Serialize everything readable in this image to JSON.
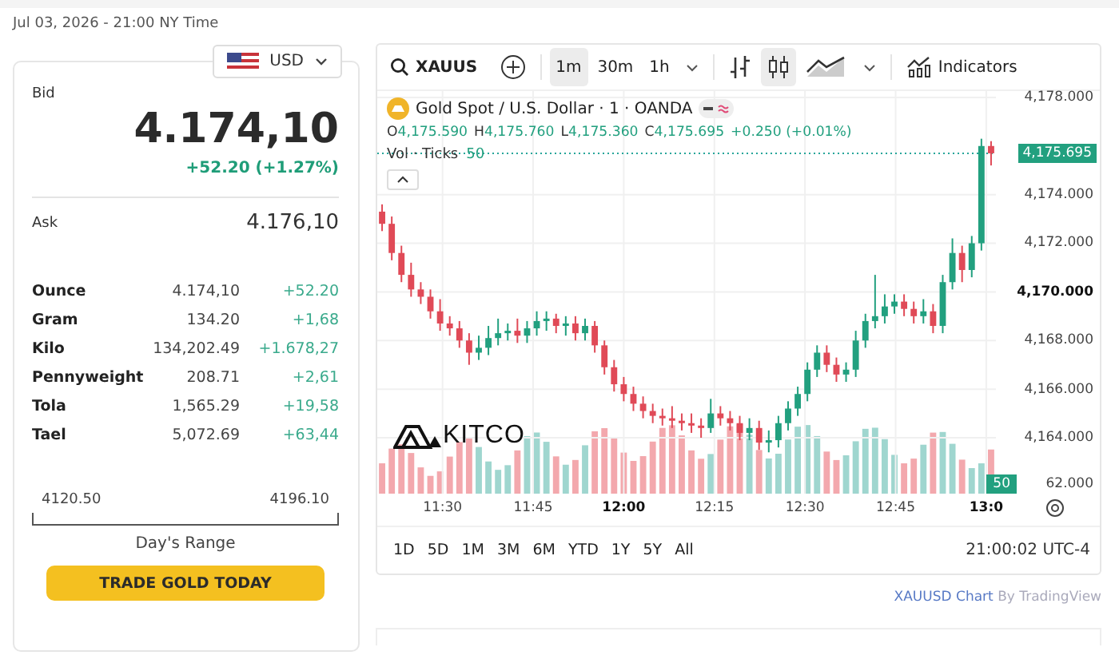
{
  "timestamp": "Jul 03, 2026 - 21:00 NY Time",
  "currency": {
    "label": "USD"
  },
  "quote": {
    "bid_label": "Bid",
    "bid": "4.174,10",
    "change": "+52.20 (+1.27%)",
    "ask_label": "Ask",
    "ask": "4.176,10"
  },
  "units": [
    {
      "name": "Ounce",
      "price": "4.174,10",
      "change": "+52.20"
    },
    {
      "name": "Gram",
      "price": "134.20",
      "change": "+1,68"
    },
    {
      "name": "Kilo",
      "price": "134,202.49",
      "change": "+1.678,27"
    },
    {
      "name": "Pennyweight",
      "price": "208.71",
      "change": "+2,61"
    },
    {
      "name": "Tola",
      "price": "1,565.29",
      "change": "+19,58"
    },
    {
      "name": "Tael",
      "price": "5,072.69",
      "change": "+63,44"
    }
  ],
  "day_range": {
    "low": "4120.50",
    "high": "4196.10",
    "label": "Day's Range"
  },
  "trade_button": "TRADE GOLD TODAY",
  "chart": {
    "symbol": "XAUUS",
    "intervals": [
      {
        "label": "1m",
        "selected": true
      },
      {
        "label": "30m",
        "selected": false
      },
      {
        "label": "1h",
        "selected": false
      }
    ],
    "styles": [
      {
        "kind": "bars",
        "selected": false
      },
      {
        "kind": "candles",
        "selected": true
      },
      {
        "kind": "area",
        "selected": false
      }
    ],
    "indicators": "Indicators",
    "title": "Gold Spot / U.S. Dollar · 1 · OANDA",
    "ohlc": [
      {
        "key": "O",
        "value": "4,175.590"
      },
      {
        "key": "H",
        "value": "4,175.760"
      },
      {
        "key": "L",
        "value": "4,175.360"
      },
      {
        "key": "C",
        "value": "4,175.695"
      }
    ],
    "delta": "+0.250 (+0.01%)",
    "volume_label": "Vol · Ticks",
    "volume_value": "50",
    "price_tag": "4,175.695",
    "volume_tag": "50",
    "cut_tick_label": "62.000",
    "major_yticks": [
      false,
      false,
      false,
      true,
      false,
      false,
      false
    ],
    "major_xticks": [
      false,
      false,
      true,
      false,
      false,
      false,
      true
    ],
    "ranges": [
      "1D",
      "5D",
      "1M",
      "3M",
      "6M",
      "YTD",
      "1Y",
      "5Y",
      "All"
    ],
    "clock": "21:00:02 UTC-4",
    "logo": "KITCO",
    "chart_data": {
      "type": "candlestick",
      "ylim": [
        4161.7,
        4178.26
      ],
      "xlim": [
        679.2,
        781.6
      ],
      "grid": true,
      "ref_lines": [
        {
          "axis": "y",
          "value": 4175.695
        }
      ],
      "yticks": [
        {
          "value": 4178,
          "label": "4,178.000"
        },
        {
          "value": 4174,
          "label": "4,174.000"
        },
        {
          "value": 4172,
          "label": "4,172.000"
        },
        {
          "value": 4170,
          "label": "4,170.000"
        },
        {
          "value": 4168,
          "label": "4,168.000"
        },
        {
          "value": 4166,
          "label": "4,166.000"
        },
        {
          "value": 4164,
          "label": "4,164.000"
        }
      ],
      "xticks": [
        {
          "value": 690,
          "label": "11:30"
        },
        {
          "value": 705,
          "label": "11:45"
        },
        {
          "value": 720,
          "label": "12:00"
        },
        {
          "value": 735,
          "label": "12:15"
        },
        {
          "value": 750,
          "label": "12:30"
        },
        {
          "value": 765,
          "label": "12:45"
        },
        {
          "value": 780,
          "label": "13:0"
        }
      ],
      "x": [
        680,
        681.6,
        683.2,
        684.8,
        686.4,
        688,
        689.6,
        691.2,
        692.8,
        694.4,
        696,
        697.6,
        699.2,
        700.8,
        702.4,
        704,
        705.6,
        707.2,
        708.8,
        710.4,
        712,
        713.6,
        715.2,
        716.8,
        718.4,
        720,
        721.6,
        723.2,
        724.8,
        726.4,
        728,
        729.6,
        731.2,
        732.8,
        734.4,
        736,
        737.6,
        739.2,
        740.8,
        742.4,
        744,
        745.6,
        747.2,
        748.8,
        750.4,
        752,
        753.6,
        755.2,
        756.8,
        758.4,
        760,
        761.6,
        763.2,
        764.8,
        766.4,
        768,
        769.6,
        771.2,
        772.8,
        774.4,
        776,
        777.6,
        779.2,
        780.8
      ],
      "ohlc": [
        [
          4173.3,
          4173.6,
          4172.5,
          4172.8
        ],
        [
          4172.8,
          4173.1,
          4171.3,
          4171.6
        ],
        [
          4171.6,
          4171.9,
          4170.4,
          4170.7
        ],
        [
          4170.7,
          4171.2,
          4169.8,
          4170.1
        ],
        [
          4170.1,
          4170.4,
          4169.5,
          4169.8
        ],
        [
          4169.8,
          4170.1,
          4168.9,
          4169.2
        ],
        [
          4169.2,
          4169.7,
          4168.4,
          4168.7
        ],
        [
          4168.7,
          4169.0,
          4168.2,
          4168.5
        ],
        [
          4168.5,
          4168.8,
          4167.7,
          4168.0
        ],
        [
          4168.0,
          4168.3,
          4167.0,
          4167.5
        ],
        [
          4167.5,
          4168.2,
          4167.2,
          4167.7
        ],
        [
          4167.7,
          4168.6,
          4167.4,
          4168.1
        ],
        [
          4168.1,
          4168.9,
          4167.8,
          4168.3
        ],
        [
          4168.3,
          4168.7,
          4168.0,
          4168.4
        ],
        [
          4168.4,
          4168.9,
          4167.9,
          4168.2
        ],
        [
          4168.2,
          4168.8,
          4167.9,
          4168.5
        ],
        [
          4168.5,
          4169.2,
          4168.2,
          4168.8
        ],
        [
          4168.8,
          4169.2,
          4168.4,
          4168.9
        ],
        [
          4168.9,
          4169.1,
          4168.3,
          4168.6
        ],
        [
          4168.6,
          4169.0,
          4168.2,
          4168.7
        ],
        [
          4168.7,
          4169.0,
          4168.0,
          4168.3
        ],
        [
          4168.3,
          4168.9,
          4168.0,
          4168.6
        ],
        [
          4168.6,
          4168.8,
          4167.5,
          4167.8
        ],
        [
          4167.8,
          4168.0,
          4166.6,
          4166.9
        ],
        [
          4166.9,
          4167.2,
          4165.9,
          4166.2
        ],
        [
          4166.2,
          4166.5,
          4165.5,
          4165.8
        ],
        [
          4165.8,
          4166.1,
          4165.1,
          4165.4
        ],
        [
          4165.4,
          4165.7,
          4164.8,
          4165.1
        ],
        [
          4165.1,
          4165.4,
          4164.6,
          4164.9
        ],
        [
          4164.9,
          4165.2,
          4164.5,
          4164.8
        ],
        [
          4164.8,
          4165.3,
          4164.4,
          4164.7
        ],
        [
          4164.7,
          4165.0,
          4164.3,
          4164.6
        ],
        [
          4164.6,
          4165.0,
          4164.2,
          4164.5
        ],
        [
          4164.5,
          4164.8,
          4164.0,
          4164.4
        ],
        [
          4164.4,
          4165.6,
          4164.2,
          4165.0
        ],
        [
          4165.0,
          4165.3,
          4164.5,
          4164.8
        ],
        [
          4164.8,
          4165.1,
          4164.3,
          4164.6
        ],
        [
          4164.6,
          4164.9,
          4163.9,
          4164.2
        ],
        [
          4164.2,
          4164.8,
          4163.9,
          4164.4
        ],
        [
          4164.4,
          4164.7,
          4163.5,
          4163.8
        ],
        [
          4163.8,
          4164.3,
          4163.4,
          4163.9
        ],
        [
          4163.9,
          4164.9,
          4163.6,
          4164.6
        ],
        [
          4164.6,
          4165.5,
          4164.3,
          4165.2
        ],
        [
          4165.2,
          4166.1,
          4164.9,
          4165.8
        ],
        [
          4165.8,
          4167.1,
          4165.5,
          4166.8
        ],
        [
          4166.8,
          4167.8,
          4166.5,
          4167.5
        ],
        [
          4167.5,
          4167.8,
          4166.7,
          4167.0
        ],
        [
          4167.0,
          4167.3,
          4166.3,
          4166.6
        ],
        [
          4166.6,
          4167.1,
          4166.3,
          4166.8
        ],
        [
          4166.8,
          4168.4,
          4166.5,
          4168.0
        ],
        [
          4168.0,
          4169.1,
          4167.7,
          4168.8
        ],
        [
          4168.8,
          4170.7,
          4168.5,
          4169.0
        ],
        [
          4169.0,
          4169.9,
          4168.7,
          4169.4
        ],
        [
          4169.4,
          4169.9,
          4169.1,
          4169.6
        ],
        [
          4169.6,
          4169.9,
          4169.0,
          4169.3
        ],
        [
          4169.3,
          4169.6,
          4168.7,
          4169.0
        ],
        [
          4169.0,
          4169.7,
          4168.7,
          4169.2
        ],
        [
          4169.2,
          4169.5,
          4168.3,
          4168.6
        ],
        [
          4168.6,
          4170.7,
          4168.3,
          4170.4
        ],
        [
          4170.4,
          4172.2,
          4170.1,
          4171.6
        ],
        [
          4171.6,
          4171.9,
          4170.4,
          4170.9
        ],
        [
          4170.9,
          4172.3,
          4170.6,
          4172.0
        ],
        [
          4172.0,
          4176.3,
          4171.7,
          4176.0
        ],
        [
          4176.0,
          4176.2,
          4175.2,
          4175.7
        ]
      ]
    }
  },
  "credit": {
    "link": "XAUUSD Chart",
    "rest": " By TradingView"
  }
}
